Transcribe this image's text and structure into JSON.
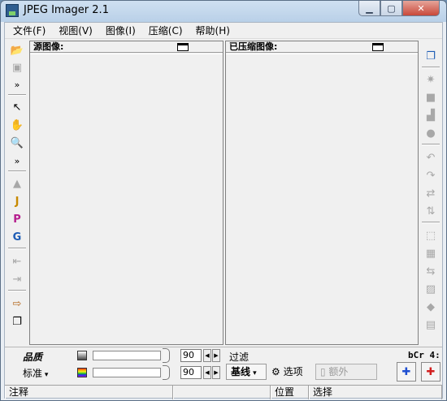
{
  "window": {
    "title": "JPEG Imager 2.1",
    "min_symbol": "▁",
    "max_symbol": "▢",
    "close_symbol": "✕"
  },
  "menu": [
    {
      "label": "文件(F)"
    },
    {
      "label": "视图(V)"
    },
    {
      "label": "图像(I)"
    },
    {
      "label": "压缩(C)"
    },
    {
      "label": "帮助(H)"
    }
  ],
  "left_toolbar": {
    "open": "📂",
    "copy": "▣",
    "more1": "»",
    "pointer": "↖",
    "hand": "✋",
    "zoom": "🔍",
    "more2": "»",
    "stamp": "▲",
    "j_tool": "J",
    "p_tool": "P",
    "g_tool": "G",
    "prev": "⇤",
    "next": "⇥",
    "export": "⇨",
    "pages": "❐"
  },
  "right_toolbar": {
    "copy_view": "❐",
    "brightness": "✷",
    "fill": "■",
    "histogram": "▟",
    "circle": "●",
    "rotate_l": "↶",
    "rotate_r": "↷",
    "flip": "⇄",
    "mirror": "⇅",
    "crop": "⬚",
    "resize": "▦",
    "adjust": "⇆",
    "sharpen": "▨",
    "drop": "◆",
    "stack": "▤"
  },
  "panes": {
    "source_title": "源图像:",
    "compressed_title": "已压缩图像:"
  },
  "bottom": {
    "quality_label": "品质",
    "standard_label": "标准",
    "quality_value_1": "90",
    "quality_value_2": "90",
    "filter_label": "过滤",
    "bcr_label": "bCr 4:",
    "baseline_label": "基线",
    "options_label": "选项",
    "extra_label": "额外",
    "spin_left": "◀",
    "spin_right": "▶",
    "gear": "⚙",
    "blue_btn": "✚",
    "red_btn": "✚"
  },
  "status": {
    "note": "注释",
    "position": "位置",
    "selection": "选择"
  },
  "colors": {
    "accent_blue": "#1f4fd1",
    "accent_red": "#d21f1f"
  }
}
